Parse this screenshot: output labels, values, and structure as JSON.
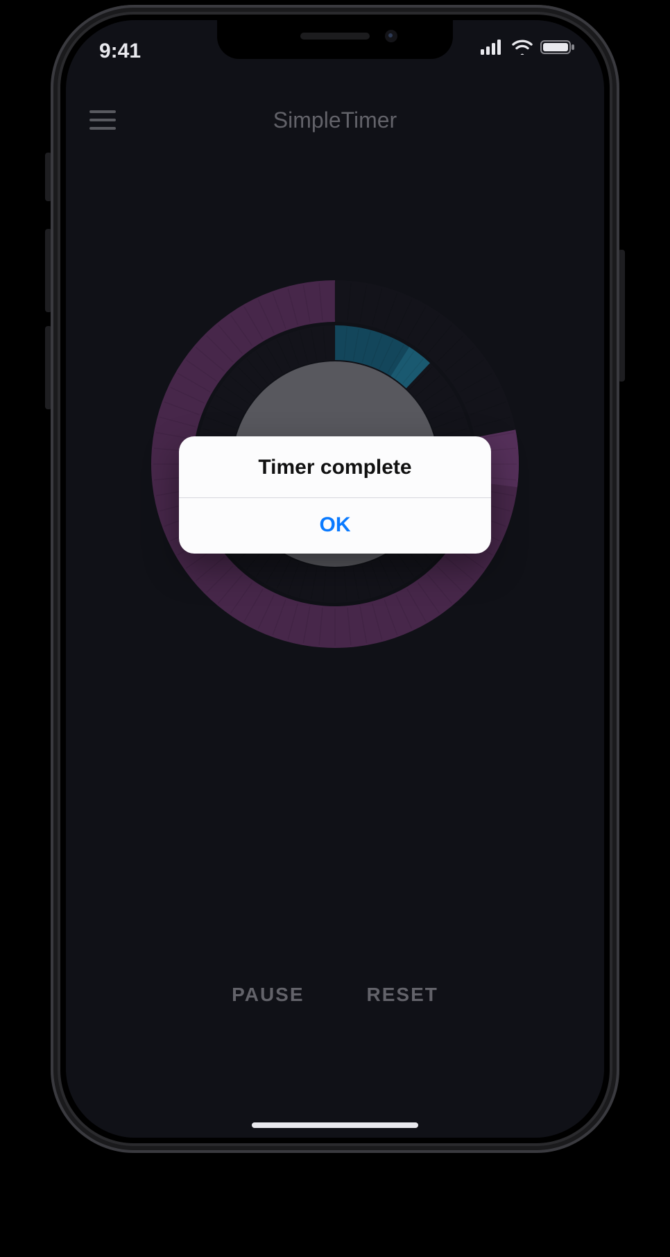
{
  "status": {
    "time": "9:41"
  },
  "header": {
    "title": "SimpleTimer"
  },
  "dial": {
    "outer_progress": 0.78,
    "inner_progress": 0.12
  },
  "footer": {
    "pause_label": "PAUSE",
    "reset_label": "RESET"
  },
  "alert": {
    "title": "Timer complete",
    "ok_label": "OK"
  },
  "colors": {
    "screen_bg": "#1a1b24",
    "outer_ring": "#6f3d74",
    "outer_ring_light": "#8b4f92",
    "inner_ring": "#1f6e8f",
    "inner_ring_light": "#2b8fb4",
    "disc": "#8a8a94",
    "text_muted": "#9a9aa5",
    "alert_accent": "#0a7aff"
  }
}
